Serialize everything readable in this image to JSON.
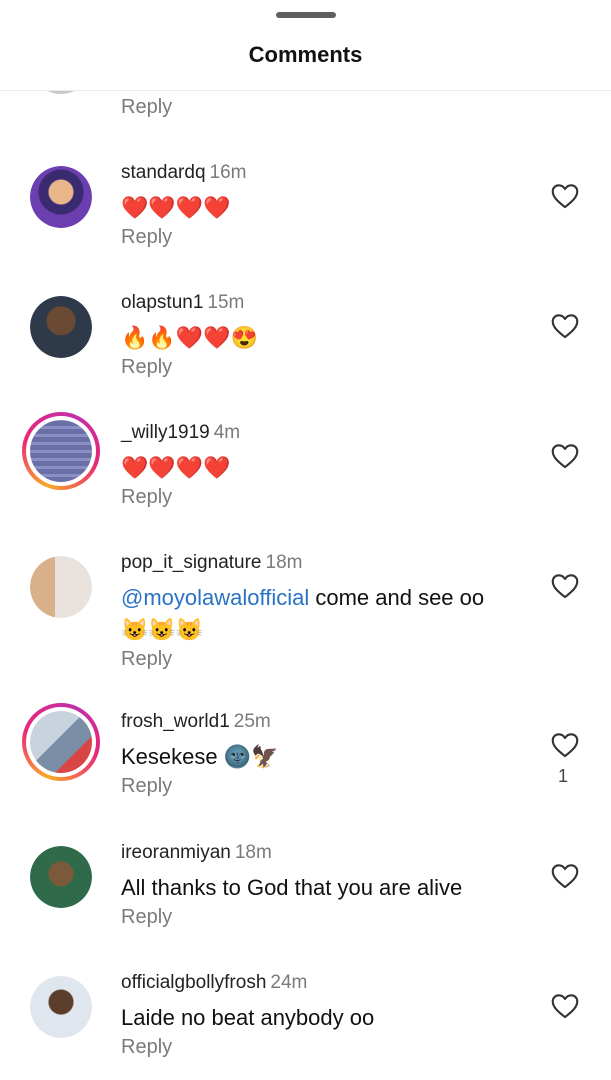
{
  "header": {
    "title": "Comments"
  },
  "top_reply_label": "Reply",
  "comments": [
    {
      "username": "standardq",
      "time": "16m",
      "text": "❤️❤️❤️❤️",
      "reply_label": "Reply",
      "likes": ""
    },
    {
      "username": "olapstun1",
      "time": "15m",
      "text": "🔥🔥❤️❤️😍",
      "reply_label": "Reply",
      "likes": ""
    },
    {
      "username": "_willy1919",
      "time": "4m",
      "text": "❤️❤️❤️❤️",
      "reply_label": "Reply",
      "likes": ""
    },
    {
      "username": "pop_it_signature",
      "time": "18m",
      "mention": "@moyolawalofficial",
      "text": " come and see oo 😺😺😺",
      "reply_label": "Reply",
      "likes": ""
    },
    {
      "username": "frosh_world1",
      "time": "25m",
      "text": "Kesekese 🌚🦅",
      "reply_label": "Reply",
      "likes": "1"
    },
    {
      "username": "ireoranmiyan",
      "time": "18m",
      "text": "All thanks to God that you are alive",
      "reply_label": "Reply",
      "likes": ""
    },
    {
      "username": "officialgbollyfrosh",
      "time": "24m",
      "text": "Laide no beat anybody oo",
      "reply_label": "Reply",
      "likes": ""
    }
  ],
  "colors": {
    "mention": "#2a72c4",
    "meta": "#7a7a7a",
    "story_ring_start": "#f9a826",
    "story_ring_end": "#c22fa8"
  },
  "icons": {
    "like": "heart-outline-icon"
  }
}
